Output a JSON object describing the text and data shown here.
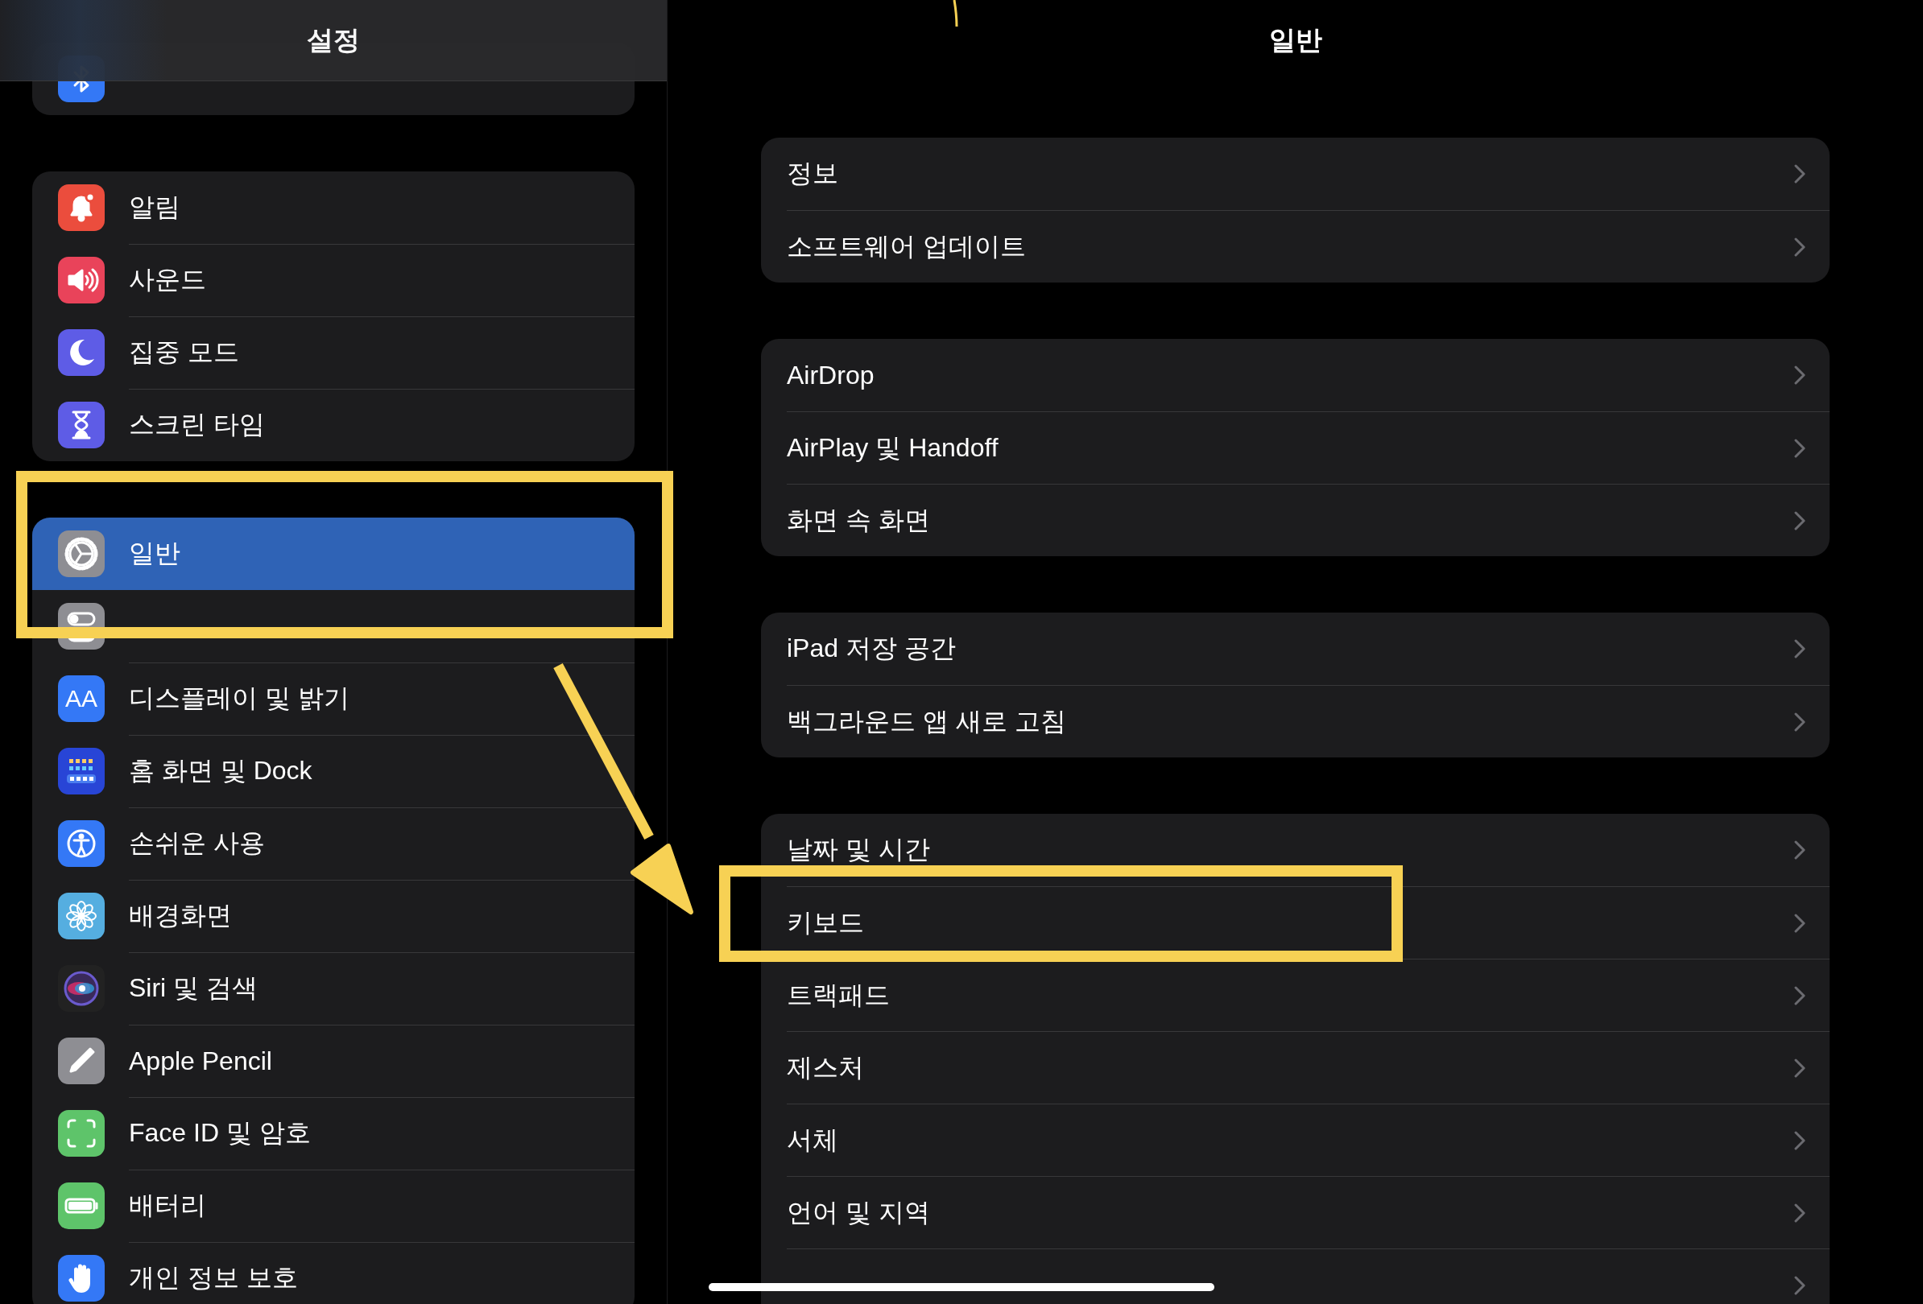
{
  "sidebar": {
    "title": "설정",
    "groups": [
      {
        "items": [
          {
            "kind": "covered",
            "selected": false
          }
        ]
      },
      {
        "items": [
          {
            "label": "알림",
            "selected": false
          },
          {
            "label": "사운드",
            "selected": false
          },
          {
            "label": "집중 모드",
            "selected": false
          },
          {
            "label": "스크린 타임",
            "selected": false
          }
        ]
      },
      {
        "items": [
          {
            "label": "일반",
            "selected": true
          },
          {
            "kind": "covered",
            "selected": false
          },
          {
            "label": "디스플레이 및 밝기",
            "selected": false,
            "icon_text": "AA"
          },
          {
            "label": "홈 화면 및 Dock",
            "selected": false
          },
          {
            "label": "손쉬운 사용",
            "selected": false
          },
          {
            "label": "배경화면",
            "selected": false
          },
          {
            "label": "Siri 및 검색",
            "selected": false
          },
          {
            "label": "Apple Pencil",
            "selected": false
          },
          {
            "label": "Face ID 및 암호",
            "selected": false
          },
          {
            "label": "배터리",
            "selected": false
          },
          {
            "label": "개인 정보 보호",
            "selected": false
          }
        ]
      }
    ]
  },
  "detail": {
    "title": "일반",
    "groups": [
      {
        "items": [
          {
            "label": "정보"
          },
          {
            "label": "소프트웨어 업데이트"
          }
        ]
      },
      {
        "items": [
          {
            "label": "AirDrop"
          },
          {
            "label": "AirPlay 및 Handoff"
          },
          {
            "label": "화면 속 화면"
          }
        ]
      },
      {
        "items": [
          {
            "label": "iPad 저장 공간"
          },
          {
            "label": "백그라운드 앱 새로 고침"
          }
        ]
      },
      {
        "items": [
          {
            "label": "날짜 및 시간"
          },
          {
            "label": "키보드"
          },
          {
            "label": "트랙패드"
          },
          {
            "label": "제스처"
          },
          {
            "label": "서체"
          },
          {
            "label": "언어 및 지역"
          },
          {
            "kind": "covered"
          }
        ]
      }
    ]
  }
}
